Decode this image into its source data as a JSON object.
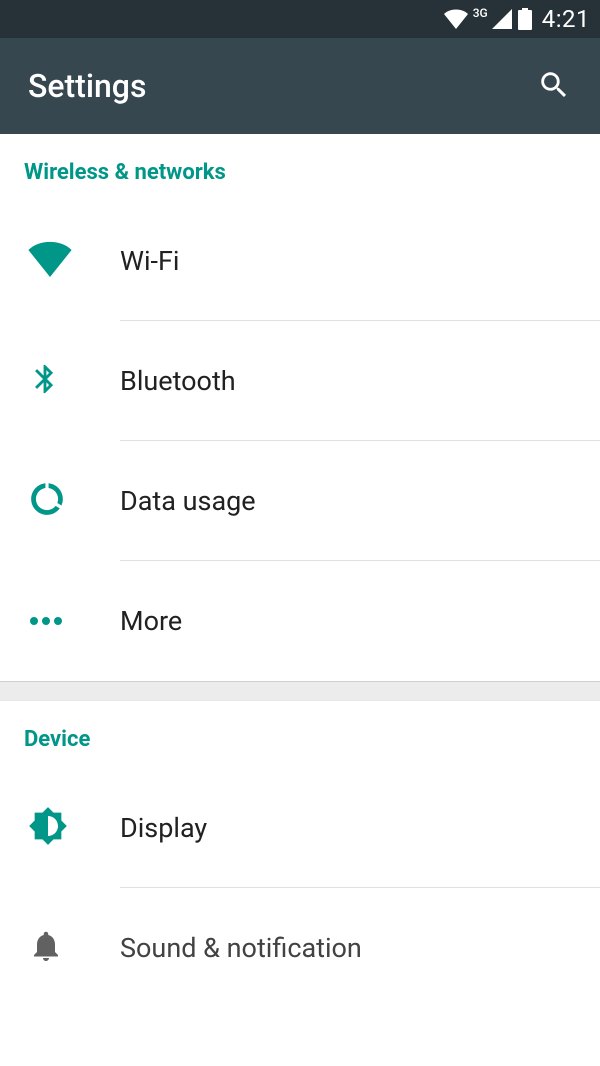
{
  "status": {
    "network_label": "3G",
    "time": "4:21"
  },
  "appbar": {
    "title": "Settings"
  },
  "sections": [
    {
      "id": "wireless",
      "header": "Wireless & networks",
      "items": [
        {
          "id": "wifi",
          "label": "Wi-Fi",
          "icon": "wifi-icon",
          "icon_color": "accent"
        },
        {
          "id": "bluetooth",
          "label": "Bluetooth",
          "icon": "bluetooth-icon",
          "icon_color": "accent"
        },
        {
          "id": "data-usage",
          "label": "Data usage",
          "icon": "data-usage-icon",
          "icon_color": "accent"
        },
        {
          "id": "more",
          "label": "More",
          "icon": "more-icon",
          "icon_color": "accent"
        }
      ]
    },
    {
      "id": "device",
      "header": "Device",
      "items": [
        {
          "id": "display",
          "label": "Display",
          "icon": "display-icon",
          "icon_color": "accent"
        },
        {
          "id": "sound-notification",
          "label": "Sound & notification",
          "icon": "notification-icon",
          "icon_color": "muted"
        }
      ]
    }
  ],
  "colors": {
    "accent": "#009688",
    "appbar_bg": "#37474F",
    "status_bg": "#263238"
  }
}
